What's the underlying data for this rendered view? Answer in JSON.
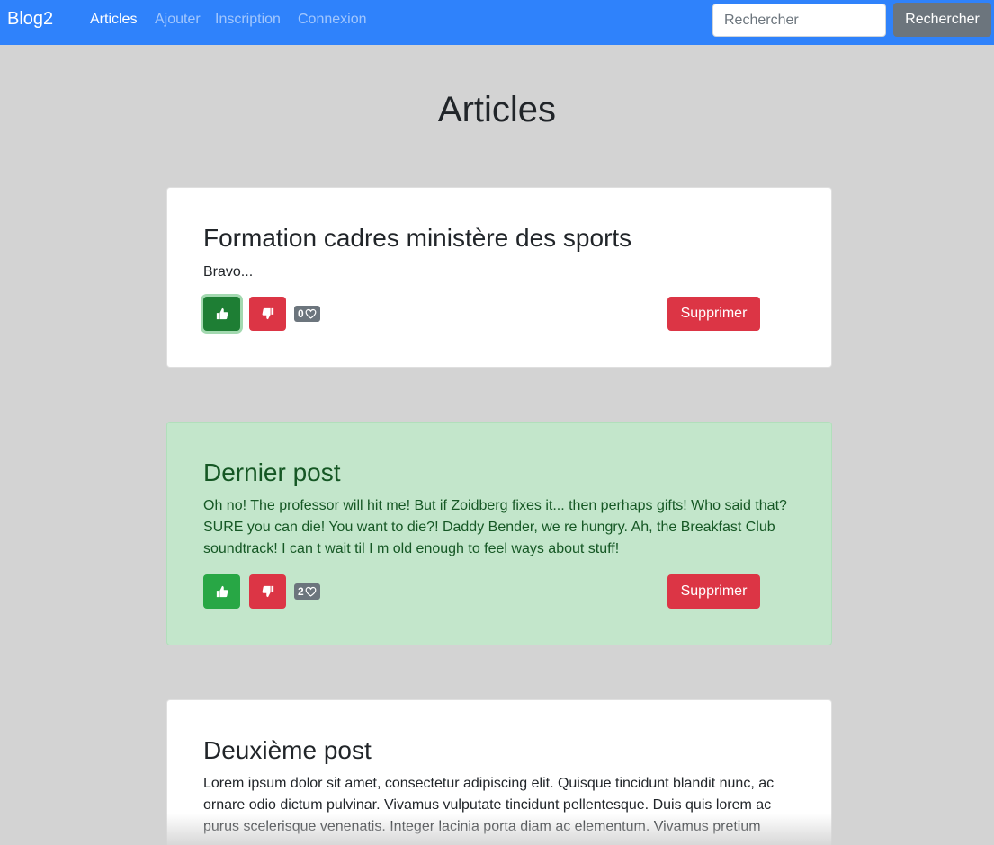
{
  "navbar": {
    "brand": "Blog2",
    "links": [
      {
        "label": "Articles",
        "active": true
      },
      {
        "label": "Ajouter",
        "active": false
      },
      {
        "label": "Inscription",
        "active": false
      },
      {
        "label": "Connexion",
        "active": false
      }
    ],
    "search_placeholder": "Rechercher",
    "search_button": "Rechercher"
  },
  "page": {
    "title": "Articles"
  },
  "articles": [
    {
      "title": "Formation cadres ministère des sports",
      "body": "Bravo...",
      "likes": "0",
      "delete_label": "Supprimer",
      "highlighted": false
    },
    {
      "title": "Dernier post",
      "body": "Oh no! The professor will hit me! But if Zoidberg fixes it... then perhaps gifts! Who said that? SURE you can die! You want to die?! Daddy Bender, we re hungry. Ah, the Breakfast Club soundtrack! I can t wait til I m old enough to feel ways about stuff!",
      "likes": "2",
      "delete_label": "Supprimer",
      "highlighted": true
    },
    {
      "title": "Deuxième post",
      "body": "Lorem ipsum dolor sit amet, consectetur adipiscing elit. Quisque tincidunt blandit nunc, ac ornare odio dictum pulvinar. Vivamus vulputate tincidunt pellentesque. Duis quis lorem ac purus scelerisque venenatis. Integer lacinia porta diam ac elementum. Vivamus pretium",
      "highlighted": false
    }
  ],
  "icons": {
    "like": "thumbs-up-icon",
    "dislike": "thumbs-down-icon",
    "heart": "heart-icon"
  },
  "colors": {
    "navbar": "#2f82fb",
    "like": "#28a745",
    "dislike": "#dc3545",
    "highlight_card": "#c3e6cb",
    "background": "#d3d3d3"
  }
}
